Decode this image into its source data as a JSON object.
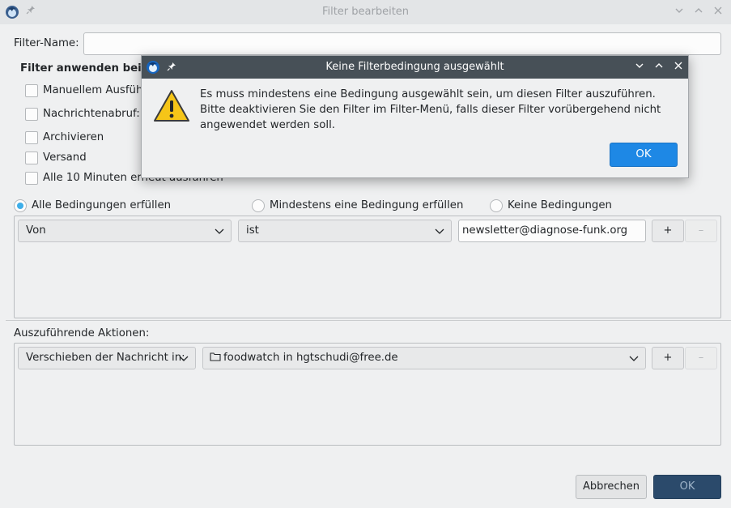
{
  "window": {
    "title": "Filter bearbeiten"
  },
  "filter_name": {
    "label": "Filter-Name:",
    "value": ""
  },
  "apply_when": {
    "heading": "Filter anwenden bei:",
    "options": [
      {
        "label": "Manuellem Ausführen",
        "checked": false
      },
      {
        "label": "Nachrichtenabruf:",
        "checked": false
      },
      {
        "label": "Archivieren",
        "checked": false
      },
      {
        "label": "Versand",
        "checked": false
      },
      {
        "label": "Alle 10 Minuten erneut ausführen",
        "checked": false
      }
    ]
  },
  "match": {
    "all": "Alle Bedingungen erfüllen",
    "any": "Mindestens eine Bedingung erfüllen",
    "none": "Keine Bedingungen",
    "selected": "all"
  },
  "condition": {
    "field": "Von",
    "operator": "ist",
    "value": "newsletter@diagnose-funk.org",
    "add": "+",
    "remove": "–"
  },
  "actions": {
    "heading": "Auszuführende Aktionen:",
    "action": "Verschieben der Nachricht in:",
    "target": "foodwatch in hgtschudi@free.de",
    "add": "+",
    "remove": "–"
  },
  "footer": {
    "cancel": "Abbrechen",
    "ok": "OK"
  },
  "dialog": {
    "title": "Keine Filterbedingung ausgewählt",
    "message": "Es muss mindestens eine Bedingung ausgewählt sein, um diesen Filter auszuführen. Bitte deaktivieren Sie den Filter im Filter-Menü, falls dieser Filter vorübergehend nicht angewendet werden soll.",
    "ok": "OK"
  },
  "colors": {
    "accent": "#1e88e5",
    "dialog_titlebar": "#475057",
    "warning": "#f5c518"
  }
}
